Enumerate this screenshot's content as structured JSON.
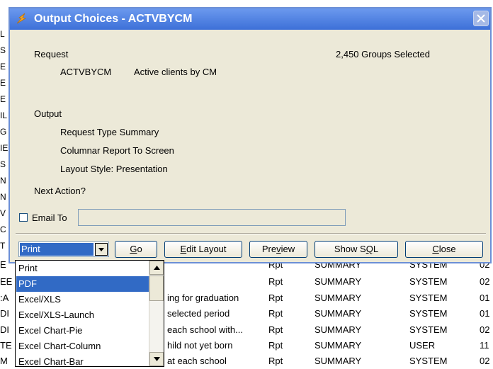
{
  "background": {
    "left_letters": [
      "L",
      "S",
      "E",
      "E",
      "E",
      "IL",
      "G",
      "IE",
      "S",
      "N",
      "N",
      "V",
      "C",
      "T"
    ],
    "rows": [
      {
        "left": "E",
        "desc": "",
        "type": "Rpt",
        "category": "SUMMARY",
        "owner": "SYSTEM",
        "num": "02"
      },
      {
        "left": "EE",
        "desc": "",
        "type": "Rpt",
        "category": "SUMMARY",
        "owner": "SYSTEM",
        "num": "02"
      },
      {
        "left": ":A",
        "desc": "ing for graduation",
        "type": "Rpt",
        "category": "SUMMARY",
        "owner": "SYSTEM",
        "num": "01"
      },
      {
        "left": "DI",
        "desc": "selected period",
        "type": "Rpt",
        "category": "SUMMARY",
        "owner": "SYSTEM",
        "num": "01"
      },
      {
        "left": "DI",
        "desc": "each school with...",
        "type": "Rpt",
        "category": "SUMMARY",
        "owner": "SYSTEM",
        "num": "02"
      },
      {
        "left": "TE",
        "desc": "hild not yet born",
        "type": "Rpt",
        "category": "SUMMARY",
        "owner": "USER",
        "num": "11"
      },
      {
        "left": "M",
        "desc": "at each school",
        "type": "Rpt",
        "category": "SUMMARY",
        "owner": "SYSTEM",
        "num": "02"
      }
    ]
  },
  "dialog": {
    "title": "Output Choices - ACTVBYCM",
    "request_label": "Request",
    "request_code": "ACTVBYCM",
    "request_desc": "Active clients by CM",
    "groups_selected": "2,450 Groups Selected",
    "output_label": "Output",
    "output_lines": [
      "Request Type Summary",
      "Columnar Report To Screen",
      "Layout Style: Presentation"
    ],
    "next_action_label": "Next Action?",
    "email_label": "Email To",
    "email_value": "",
    "action_selected": "Print",
    "buttons": {
      "go": {
        "u": "G",
        "rest": "o"
      },
      "edit_layout": {
        "u": "E",
        "rest": "dit Layout"
      },
      "preview": {
        "pre": "Pre",
        "u": "v",
        "rest": "iew"
      },
      "show_sql": {
        "pre": "Show S",
        "u": "Q",
        "rest": "L"
      },
      "close": {
        "u": "C",
        "rest": "lose"
      }
    }
  },
  "dropdown": {
    "options": [
      "Print",
      "PDF",
      "Excel/XLS",
      "Excel/XLS-Launch",
      "Excel Chart-Pie",
      "Excel Chart-Column",
      "Excel Chart-Bar"
    ],
    "highlighted": "PDF"
  },
  "colors": {
    "title_bar": "#3d70d8",
    "selection": "#316ac5",
    "dialog_bg": "#ece9d8"
  }
}
